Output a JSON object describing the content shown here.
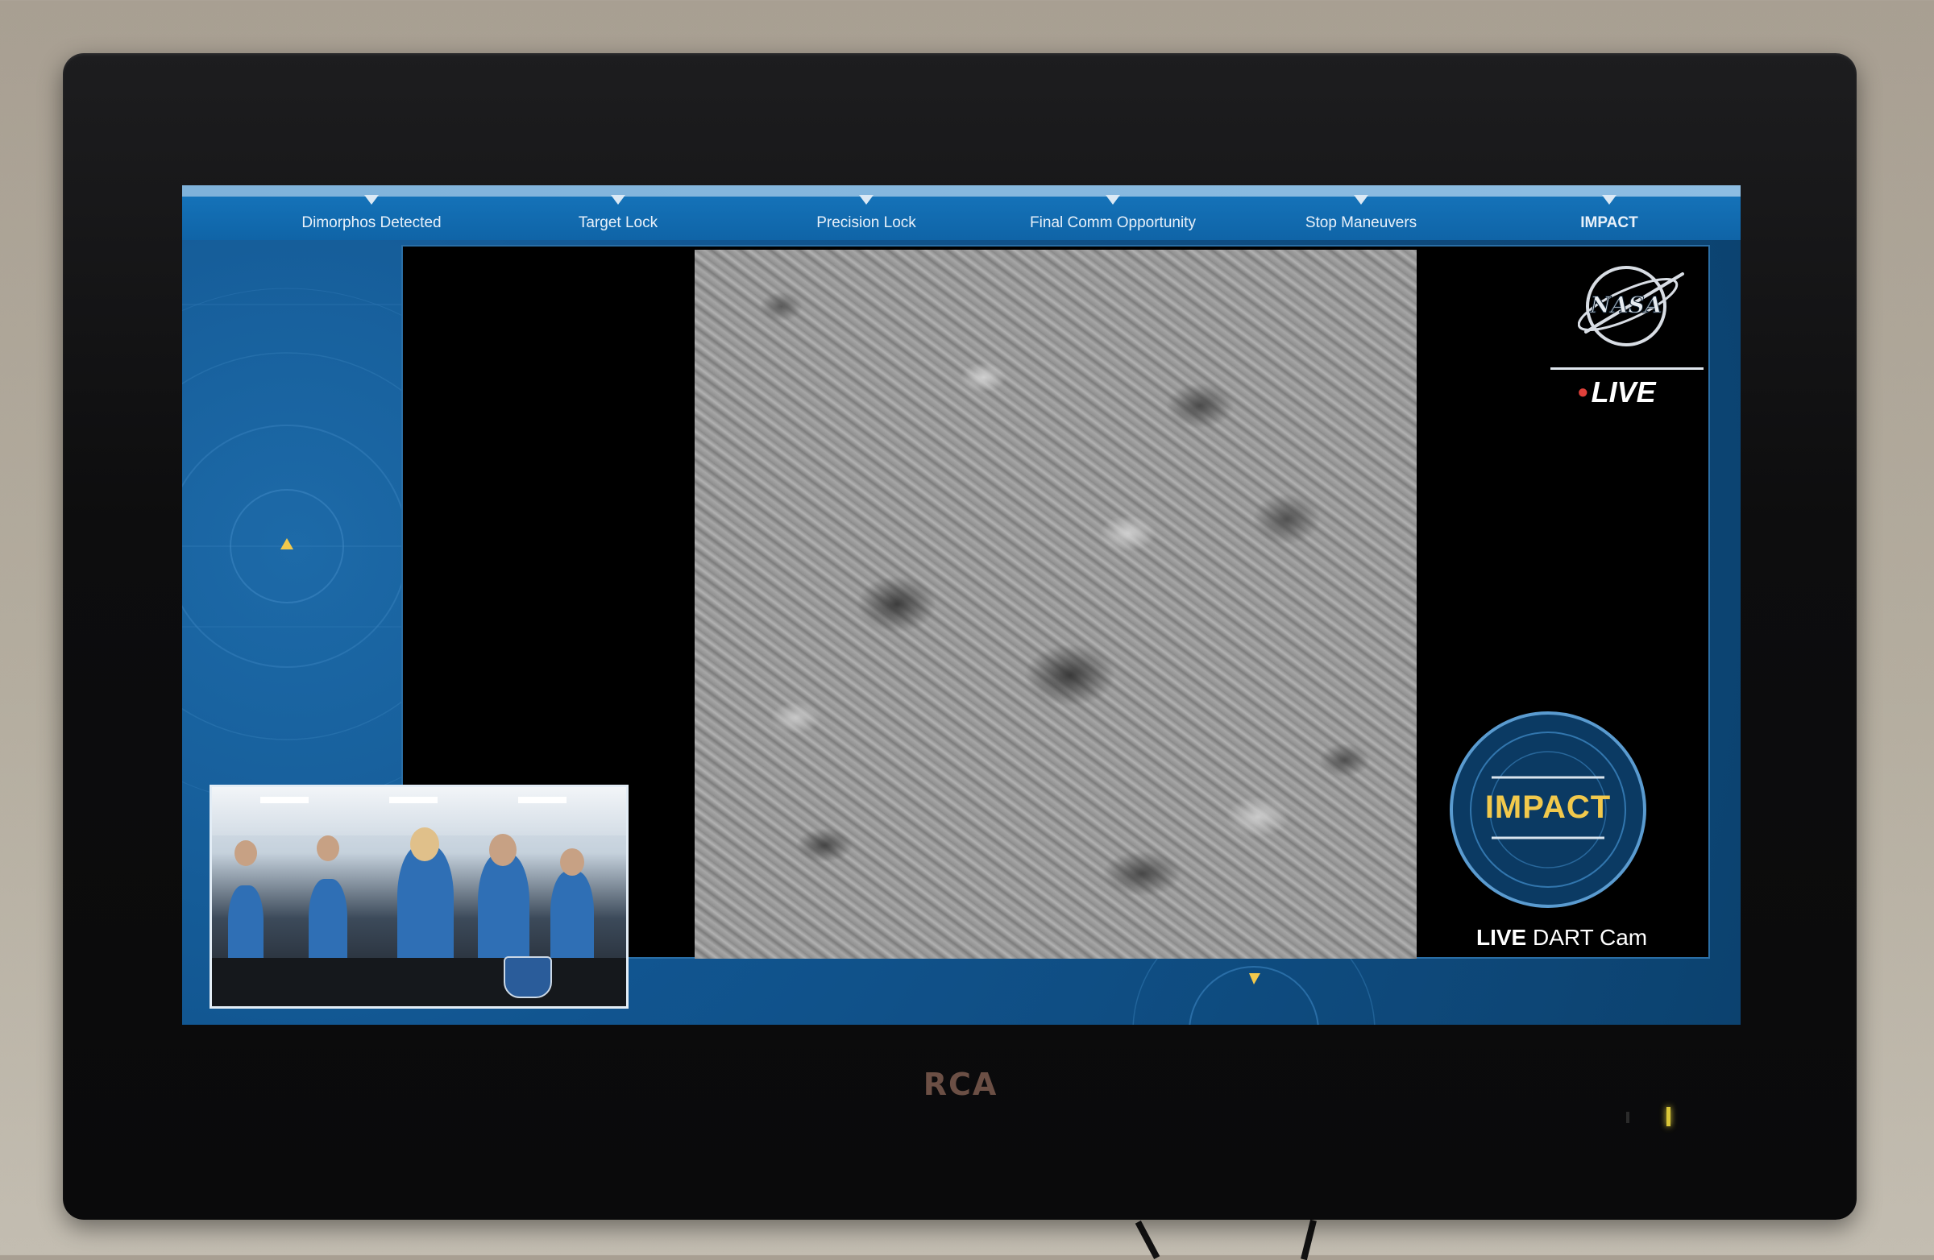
{
  "monitor": {
    "brand": "RCA"
  },
  "timeline": {
    "milestones": [
      {
        "label": "Dimorphos Detected"
      },
      {
        "label": "Target Lock"
      },
      {
        "label": "Precision Lock"
      },
      {
        "label": "Final Comm Opportunity"
      },
      {
        "label": "Stop Maneuvers"
      },
      {
        "label": "IMPACT"
      }
    ]
  },
  "broadcast": {
    "logo_text": "NASA",
    "live_label": "LIVE",
    "impact_badge": "IMPACT",
    "camera_label_live": "LIVE",
    "camera_label_name": "DART Cam"
  },
  "colors": {
    "screen_blue": "#0f4e86",
    "timeline_blue": "#1676bd",
    "impact_gold": "#f2c94c",
    "live_red": "#e0403a"
  },
  "icons": {
    "nasa": "nasa-logo-icon",
    "impact": "impact-target-icon",
    "pip_logo": "apl-shield-icon"
  }
}
